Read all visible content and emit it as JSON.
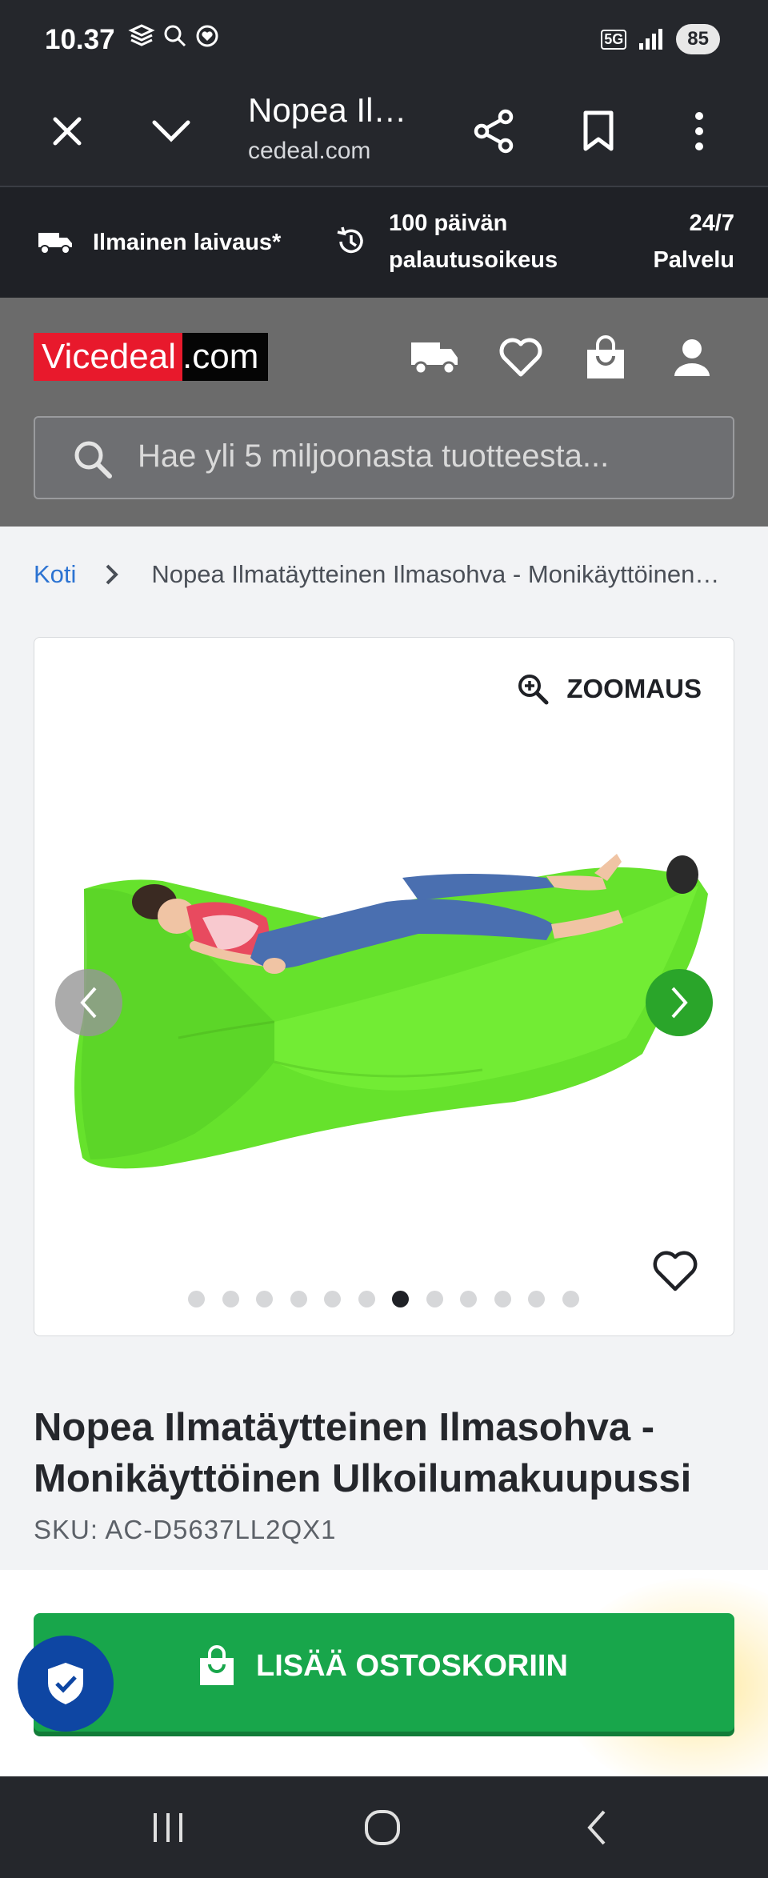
{
  "status_bar": {
    "time": "10.37",
    "network": "5G",
    "battery": "85"
  },
  "browser": {
    "title": "Nopea Il…",
    "url": "cedeal.com"
  },
  "promo": {
    "shipping": "Ilmainen laivaus*",
    "returns_line1": "100 päivän",
    "returns_line2": "palautusoikeus",
    "service_line1": "24/7",
    "service_line2": "Palvelu"
  },
  "header": {
    "logo_part1": "Vicedeal",
    "logo_part2": ".com",
    "search_placeholder": "Hae yli 5 miljoonasta tuotteesta..."
  },
  "breadcrumb": {
    "home": "Koti",
    "current": "Nopea Ilmatäytteinen Ilmasohva - Monikäyttöinen…"
  },
  "gallery": {
    "zoom_label": "ZOOMAUS",
    "dot_count": 12,
    "active_index": 6
  },
  "product": {
    "title_line1": "Nopea Ilmatäytteinen Ilmasohva -",
    "title_line2": "Monikäyttöinen Ulkoilumakuupussi",
    "sku": "SKU: AC-D5637LL2QX1"
  },
  "cart": {
    "button_label": "LISÄÄ OSTOSKORIIN"
  },
  "colors": {
    "accent_green": "#18a64b",
    "logo_red": "#e8192c",
    "trust_blue": "#0e46a3",
    "link_blue": "#2c73d2"
  }
}
